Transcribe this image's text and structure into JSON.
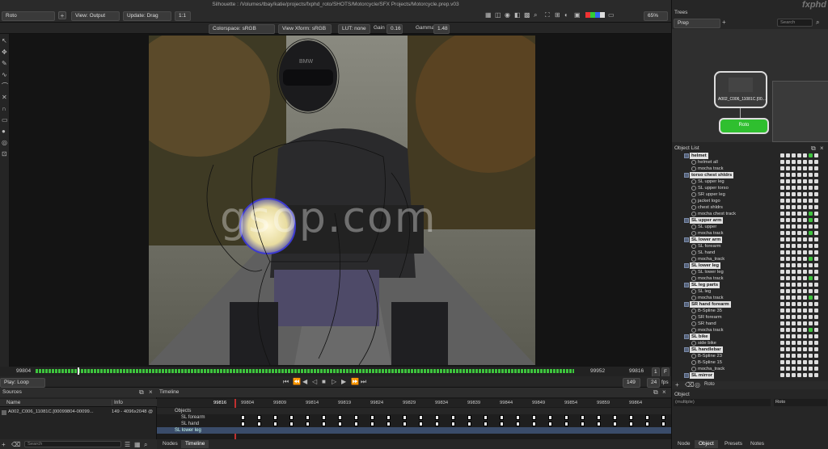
{
  "window": {
    "title": "Silhouette : /Volumes/tbay/katie/projects/fxphd_roto/SHOTS/Motorcycle/SFX Projects/Motorcycle.prep.v03",
    "brand": "fxphd"
  },
  "toolbar": {
    "tool": "Roto",
    "view": "View: Output",
    "update": "Update: Drag",
    "ratio": "1:1",
    "zoom": "65%"
  },
  "viewer_bar": {
    "colorspace": "Colorspace: sRGB",
    "view_xform": "View Xform: sRGB",
    "lut": "LUT: none",
    "gain_label": "Gain",
    "gain_value": "0.16",
    "gamma_label": "Gamma",
    "gamma_value": "1.48"
  },
  "watermark": "gsop.com",
  "frame": {
    "helmet_text": "BMW"
  },
  "scrub": {
    "start": "99804",
    "end_a": "99952",
    "end_b": "99816",
    "step": "1",
    "f": "F"
  },
  "playbar": {
    "mode": "Play: Loop",
    "frame": "149",
    "fps": "24",
    "fps_label": "fps"
  },
  "sources": {
    "title": "Sources",
    "col_name": "Name",
    "col_info": "Info",
    "row_name": "A002_C006_11081C.[00099804-00099...",
    "row_info": "149 - 4096x2048 @",
    "search_placeholder": "Search"
  },
  "timeline": {
    "title": "Timeline",
    "current": "99816",
    "ticks": [
      "99804",
      "99809",
      "99814",
      "99819",
      "99824",
      "99829",
      "99834",
      "99839",
      "99844",
      "99849",
      "99854",
      "99859",
      "99864"
    ],
    "tracks": [
      {
        "name": "Objects"
      },
      {
        "name": "SL forearm"
      },
      {
        "name": "SL hand"
      },
      {
        "name": "SL lower leg"
      }
    ],
    "tabs": [
      "Nodes",
      "Timeline"
    ]
  },
  "trees": {
    "title": "Trees",
    "selected": "Prep",
    "search_placeholder": "Search",
    "node_source": "A002_C006_11081C.[00...",
    "node_roto": "Roto"
  },
  "object_list": {
    "title": "Object List",
    "footer_label": "Roto",
    "items": [
      {
        "name": "helmet",
        "group": true
      },
      {
        "name": "helmet all",
        "group": false
      },
      {
        "name": "mocha track",
        "group": false
      },
      {
        "name": "torso chest shldrs",
        "group": true
      },
      {
        "name": "SL upper leg",
        "group": false
      },
      {
        "name": "SL upper torso",
        "group": false
      },
      {
        "name": "SR upper leg",
        "group": false
      },
      {
        "name": "jacket logo",
        "group": false
      },
      {
        "name": "chest shldrs",
        "group": false
      },
      {
        "name": "mocha chest track",
        "group": false
      },
      {
        "name": "SL upper arm",
        "group": true
      },
      {
        "name": "SL upper",
        "group": false
      },
      {
        "name": "mocha track",
        "group": false
      },
      {
        "name": "SL lower arm",
        "group": true
      },
      {
        "name": "SL forearm",
        "group": false
      },
      {
        "name": "SL hand",
        "group": false
      },
      {
        "name": "mocha_track",
        "group": false
      },
      {
        "name": "SL lower leg",
        "group": true
      },
      {
        "name": "SL lower leg",
        "group": false
      },
      {
        "name": "mocha track",
        "group": false
      },
      {
        "name": "SL leg parts",
        "group": true
      },
      {
        "name": "SL leg",
        "group": false
      },
      {
        "name": "mocha track",
        "group": false
      },
      {
        "name": "SR hand forearm",
        "group": true
      },
      {
        "name": "B-Spline 35",
        "group": false
      },
      {
        "name": "SR forearm",
        "group": false
      },
      {
        "name": "SR hand",
        "group": false
      },
      {
        "name": "mocha track",
        "group": false
      },
      {
        "name": "SL bike",
        "group": true
      },
      {
        "name": "side bike",
        "group": false
      },
      {
        "name": "SL handlebar",
        "group": true
      },
      {
        "name": "B-Spline 23",
        "group": false
      },
      {
        "name": "B-Spline 15",
        "group": false
      },
      {
        "name": "mocha_track",
        "group": false
      },
      {
        "name": "SL mirror",
        "group": true
      }
    ]
  },
  "object_panel": {
    "title": "Object",
    "field_a": "(multiple)",
    "field_b": "Roto",
    "tabs": [
      "Node",
      "Object",
      "Presets",
      "Notes"
    ],
    "active_tab": "Object"
  },
  "colors": {
    "accent_green": "#3ec43e",
    "node_green": "#2fbf2f",
    "bg": "#1e1e1e"
  }
}
